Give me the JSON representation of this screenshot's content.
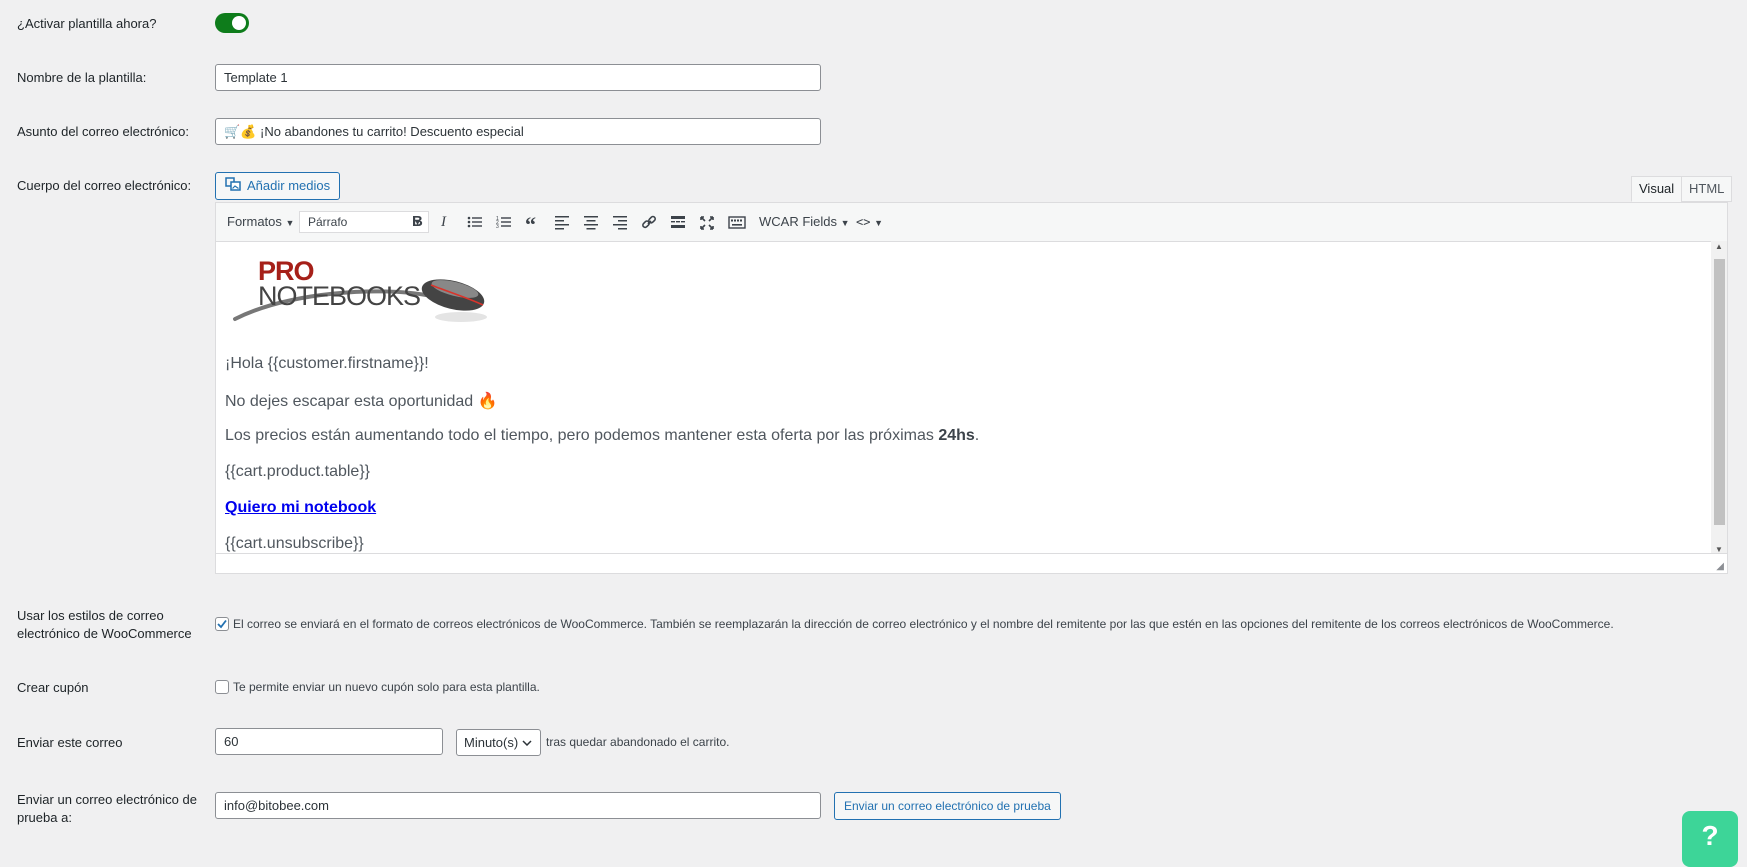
{
  "activate": {
    "label": "¿Activar plantilla ahora?",
    "enabled": true
  },
  "template_name": {
    "label": "Nombre de la plantilla:",
    "value": "Template 1"
  },
  "subject": {
    "label": "Asunto del correo electrónico:",
    "emoji": "🛒💰",
    "value": "¡No abandones tu carrito! Descuento especial"
  },
  "body": {
    "label": "Cuerpo del correo electrónico:",
    "add_media": "Añadir medios",
    "tabs": [
      "Visual",
      "HTML"
    ],
    "active_tab": "Visual",
    "toolbar": {
      "formats": "Formatos",
      "paragraph": "Párrafo",
      "wcar_fields": "WCAR Fields"
    },
    "logo": {
      "line1": "PRO",
      "line2": "NOTEBOOKS"
    },
    "greeting": "¡Hola {{customer.firstname}}!",
    "line1": "No dejes escapar esta oportunidad",
    "line1_emoji": "🔥",
    "line2_pre": "Los precios están aumentando todo el tiempo, pero podemos mantener esta oferta por las próximas",
    "line2_bold": "24hs",
    "line2_post": ".",
    "product_table": "{{cart.product.table}}",
    "cta": "Quiero mi notebook",
    "unsubscribe": "{{cart.unsubscribe}}"
  },
  "woo_styles": {
    "label_line1": "Usar los estilos de correo",
    "label_line2": "electrónico de WooCommerce",
    "checked": true,
    "description": "El correo se enviará en el formato de correos electrónicos de WooCommerce. También se reemplazarán la dirección de correo electrónico y el nombre del remitente por las que estén en las opciones del remitente de los correos electrónicos de WooCommerce."
  },
  "coupon": {
    "label": "Crear cupón",
    "checked": false,
    "description": "Te permite enviar un nuevo cupón solo para esta plantilla."
  },
  "send_after": {
    "label": "Enviar este correo",
    "value": "60",
    "unit": "Minuto(s)",
    "suffix": "tras quedar abandonado el carrito."
  },
  "test_email": {
    "label_line1": "Enviar un correo electrónico de",
    "label_line2": "prueba a:",
    "value": "info@bitobee.com",
    "button": "Enviar un correo electrónico de prueba"
  },
  "help": {
    "label": "?"
  },
  "colors": {
    "toggle_on": "#0e7c1b",
    "accent": "#2271b1",
    "help": "#3dd598",
    "link": "#0000ee"
  }
}
